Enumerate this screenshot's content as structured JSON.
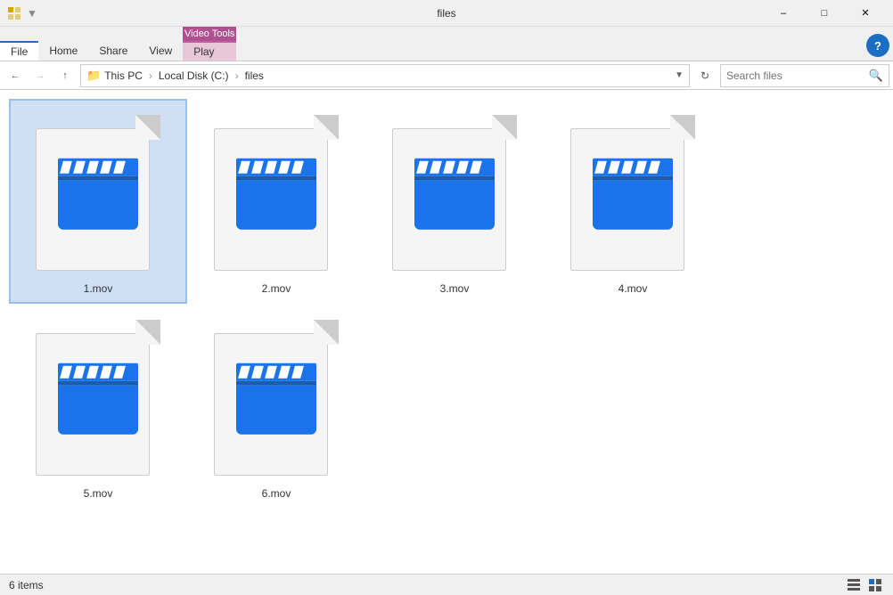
{
  "titlebar": {
    "title": "files",
    "minimize": "–",
    "maximize": "□",
    "close": "✕"
  },
  "ribbon": {
    "video_tools_label": "Video Tools",
    "tabs": [
      "File",
      "Home",
      "Share",
      "View",
      "Play"
    ]
  },
  "address": {
    "back_tooltip": "Back",
    "forward_tooltip": "Forward",
    "up_tooltip": "Up",
    "breadcrumbs": [
      "This PC",
      "Local Disk (C:)",
      "files"
    ],
    "refresh_tooltip": "Refresh",
    "search_placeholder": "Search files"
  },
  "files": [
    {
      "name": "1.mov",
      "selected": true
    },
    {
      "name": "2.mov",
      "selected": false
    },
    {
      "name": "3.mov",
      "selected": false
    },
    {
      "name": "4.mov",
      "selected": false
    },
    {
      "name": "5.mov",
      "selected": false
    },
    {
      "name": "6.mov",
      "selected": false
    }
  ],
  "statusbar": {
    "item_count": "6 items"
  }
}
